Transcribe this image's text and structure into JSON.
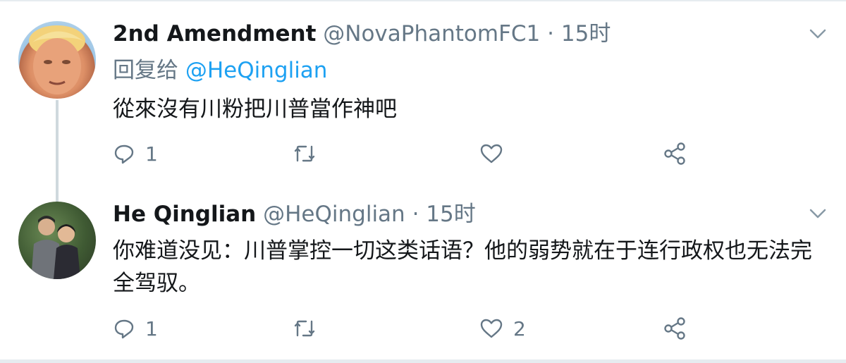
{
  "tweets": [
    {
      "name": "2nd Amendment",
      "handle": "@NovaPhantomFC1",
      "separator": "·",
      "time": "15时",
      "reply_prefix": "回复给",
      "reply_mention": "@HeQinglian",
      "text": "從來沒有川粉把川普當作神吧",
      "reply_count": "1",
      "retweet_count": "",
      "like_count": ""
    },
    {
      "name": "He Qinglian",
      "handle": "@HeQinglian",
      "separator": "·",
      "time": "15时",
      "text": "你难道没见：川普掌控一切这类话语？他的弱势就在于连行政权也无法完全驾驭。",
      "reply_count": "1",
      "retweet_count": "",
      "like_count": "2"
    }
  ],
  "icons": {
    "reply": "reply-icon",
    "retweet": "retweet-icon",
    "like": "heart-icon",
    "share": "share-icon",
    "menu": "chevron-down-icon"
  },
  "colors": {
    "text": "#14171a",
    "secondary": "#657786",
    "link": "#1da1f2",
    "divider": "#e6ecf0"
  }
}
